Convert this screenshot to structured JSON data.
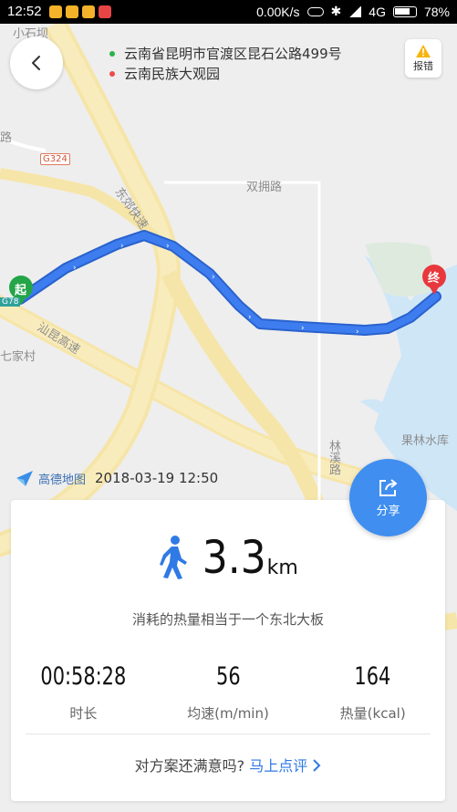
{
  "status_bar": {
    "time": "12:52",
    "network_speed": "0.00K/s",
    "network_type": "4G",
    "battery": "78%"
  },
  "map": {
    "labels": {
      "xiaoshiba": "小石坝",
      "g324": "G324",
      "g78": "G78",
      "shuangyong": "双拥路",
      "dongjiao": "东郊快速",
      "shankun": "汕昆高速",
      "qijiacun": "七家村",
      "linxi": "林溪路",
      "guolin": "果林水库",
      "lu": "路"
    },
    "start_marker": "起",
    "end_marker": "终",
    "route_color": "#3d7df0"
  },
  "header": {
    "start_address": "云南省昆明市官渡区昆石公路499号",
    "end_address": "云南民族大观园",
    "report_label": "报错"
  },
  "brand": {
    "name": "高德地图",
    "datetime": "2018-03-19  12:50"
  },
  "share": {
    "label": "分享"
  },
  "summary": {
    "distance": "3.3",
    "unit": "km",
    "calorie_text": "消耗的热量相当于一个东北大板",
    "stats": [
      {
        "value": "00:58:28",
        "label": "时长"
      },
      {
        "value": "56",
        "label": "均速(m/min)"
      },
      {
        "value": "164",
        "label": "热量(kcal)"
      }
    ],
    "feedback_question": "对方案还满意吗?",
    "feedback_link": "马上点评"
  }
}
